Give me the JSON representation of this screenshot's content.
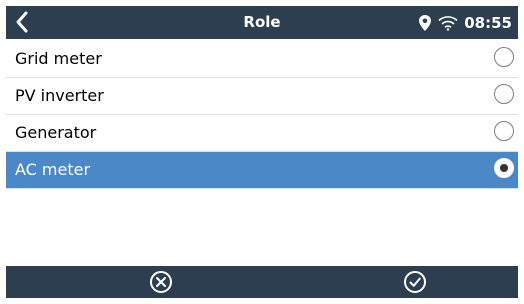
{
  "header": {
    "title": "Role",
    "time": "08:55"
  },
  "options": [
    {
      "label": "Grid meter",
      "selected": false
    },
    {
      "label": "PV inverter",
      "selected": false
    },
    {
      "label": "Generator",
      "selected": false
    },
    {
      "label": "AC meter",
      "selected": true
    }
  ],
  "colors": {
    "topbar": "#2c3e50",
    "selected_row": "#4a88c8",
    "bottombar": "#2c3e50"
  },
  "icons": {
    "back": "chevron-left-icon",
    "location": "location-pin-icon",
    "wifi": "wifi-icon",
    "cancel": "cancel-circle-icon",
    "confirm": "check-circle-icon"
  }
}
